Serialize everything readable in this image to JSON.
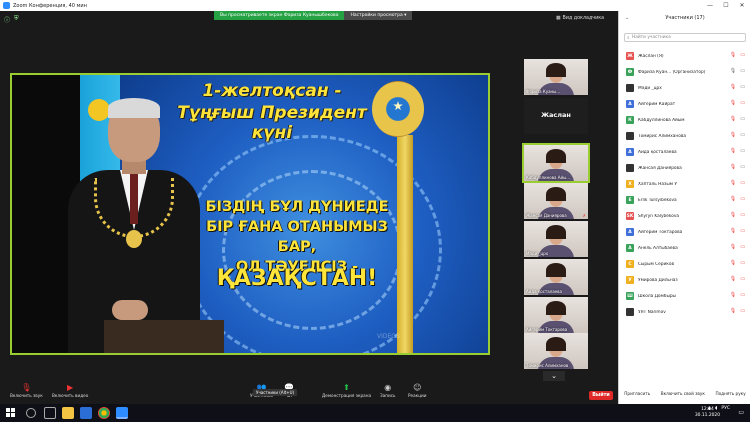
{
  "window": {
    "title": "Zoom Конференция, 40 мин",
    "minimize": "—",
    "maximize": "☐",
    "close": "✕"
  },
  "share_banner": {
    "message": "Вы просматриваете экран Фариза Куанышбекова",
    "options": "Настройки просмотра ▾"
  },
  "gallery_view": "Вид докладчика",
  "slide": {
    "line1": "1-желтоқсан -",
    "line2": "Тұңғыш Президент күні",
    "slogan1": "БІЗДІҢ БҰЛ ДҮНИЕДЕ",
    "slogan2": "БІР ҒАНА ОТАНЫМЫЗ БАР,",
    "slogan3": "ОЛ ТӘУЕЛСІЗ -",
    "slogan4": "ҚАЗАҚСТАН!",
    "watermark": "VIDEOS"
  },
  "thumbnails": [
    {
      "label": "Фариза Куаны..."
    },
    {
      "label": "Жаслан"
    },
    {
      "label": "Кабдуллинова Айы..."
    },
    {
      "label": "Жансая Даниярова"
    },
    {
      "label": "Мәди _црх"
    },
    {
      "label": "Аида қосталаева"
    },
    {
      "label": "Айгерим Токтарова"
    },
    {
      "label": "Томирис Алимханов"
    }
  ],
  "toolbar": {
    "audio": "Включить звук",
    "video": "Включить видео",
    "participants": "Участники",
    "chat": "Чат",
    "share": "Демонстрация экрана",
    "record": "Запись",
    "reactions": "Реакции",
    "tooltip": "Участники (Alt+U)",
    "leave": "Выйти"
  },
  "panel": {
    "title": "Участники (17)",
    "search_placeholder": "Найти участника",
    "invite": "Пригласить",
    "unmute_self": "Включить свой звук",
    "raise_hand": "Поднять руку",
    "participants": [
      {
        "initial": "Ж",
        "color": "#e55353",
        "name": "Жаслан (Я)"
      },
      {
        "initial": "Ф",
        "color": "#3aa35b",
        "name": "Фариза Куан... (Организатор)"
      },
      {
        "initial": "",
        "color": "#333333",
        "name": "Мәди _црх"
      },
      {
        "initial": "А",
        "color": "#3f6fd8",
        "name": "Айгерим Кайрат"
      },
      {
        "initial": "К",
        "color": "#3aa35b",
        "name": "Кабдуллинова Айым"
      },
      {
        "initial": "",
        "color": "#333333",
        "name": "Томирис Алимханова"
      },
      {
        "initial": "А",
        "color": "#3f6fd8",
        "name": "Аида қосталаева"
      },
      {
        "initial": "",
        "color": "#333333",
        "name": "Жансая Даниярова"
      },
      {
        "initial": "Х",
        "color": "#f0b020",
        "name": "Хапталь Назым У"
      },
      {
        "initial": "E",
        "color": "#3aa35b",
        "name": "Erlik Tursyibekova"
      },
      {
        "initial": "SK",
        "color": "#e55353",
        "name": "Shyryn Kalybekova"
      },
      {
        "initial": "А",
        "color": "#3f6fd8",
        "name": "Айгерим Токтарова"
      },
      {
        "initial": "А",
        "color": "#3aa35b",
        "name": "Анель Алтыбаева"
      },
      {
        "initial": "С",
        "color": "#f0b020",
        "name": "Сырым Сериков"
      },
      {
        "initial": "У",
        "color": "#f0b020",
        "name": "Умирова Дильназ"
      },
      {
        "initial": "Ш",
        "color": "#3aa35b",
        "name": "Школа Домбыры"
      },
      {
        "initial": "",
        "color": "#333333",
        "name": "ҰЯТ Narimov"
      }
    ]
  },
  "taskbar": {
    "time": "12:04",
    "date": "30.11.2020",
    "lang": "РУС"
  },
  "colors": {
    "accent_green": "#9acd32",
    "leave_red": "#e02828"
  }
}
